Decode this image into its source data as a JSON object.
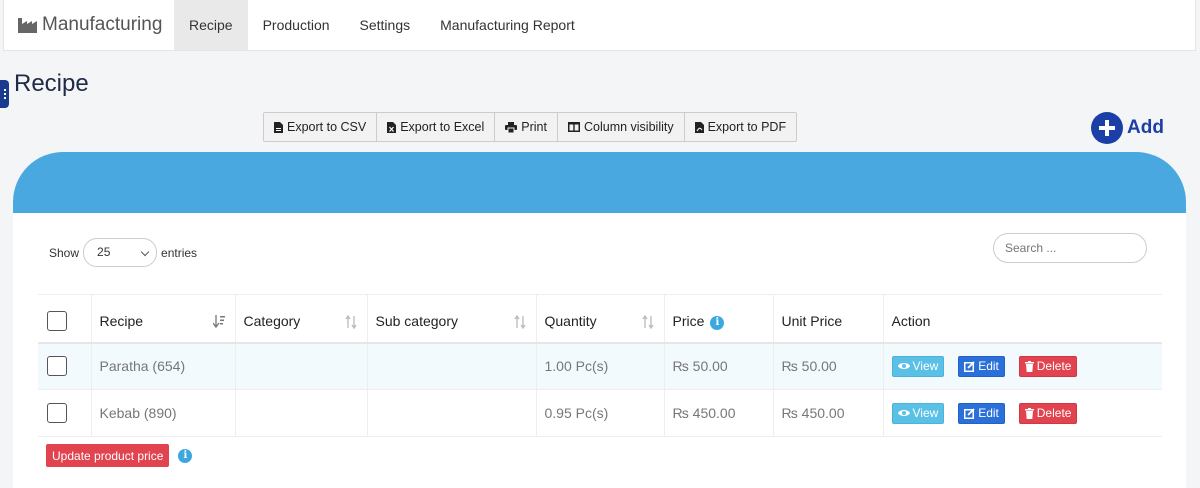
{
  "nav": {
    "brand": "Manufacturing",
    "brand_icon": "factory-icon",
    "items": [
      {
        "label": "Recipe",
        "active": true
      },
      {
        "label": "Production",
        "active": false
      },
      {
        "label": "Settings",
        "active": false
      },
      {
        "label": "Manufacturing Report",
        "active": false
      }
    ]
  },
  "page": {
    "title": "Recipe"
  },
  "toolbar": {
    "buttons": [
      {
        "label": "Export to CSV",
        "icon": "file-csv-icon"
      },
      {
        "label": "Export to Excel",
        "icon": "file-excel-icon"
      },
      {
        "label": "Print",
        "icon": "print-icon"
      },
      {
        "label": "Column visibility",
        "icon": "columns-icon"
      },
      {
        "label": "Export to PDF",
        "icon": "file-pdf-icon"
      }
    ]
  },
  "add": {
    "label": "Add",
    "icon": "plus-circle-icon"
  },
  "colors": {
    "header_band": "#48a8df",
    "accent": "#1c3fa7",
    "danger": "#e1434f",
    "info": "#5bc0e6",
    "primary": "#2a70d8"
  },
  "length": {
    "show_label": "Show",
    "value": "25",
    "entries_label": "entries"
  },
  "search": {
    "placeholder": "Search ..."
  },
  "table": {
    "columns": [
      "Recipe",
      "Category",
      "Sub category",
      "Quantity",
      "Price",
      "Unit Price",
      "Action"
    ],
    "rows": [
      {
        "recipe": "Paratha (654)",
        "category": "",
        "sub_category": "",
        "quantity": "1.00 Pc(s)",
        "price": "₨ 50.00",
        "unit_price": "₨ 50.00"
      },
      {
        "recipe": "Kebab (890)",
        "category": "",
        "sub_category": "",
        "quantity": "0.95 Pc(s)",
        "price": "₨ 450.00",
        "unit_price": "₨ 450.00"
      }
    ],
    "actions": {
      "view": "View",
      "edit": "Edit",
      "delete": "Delete"
    }
  },
  "update_price": {
    "label": "Update product price"
  }
}
